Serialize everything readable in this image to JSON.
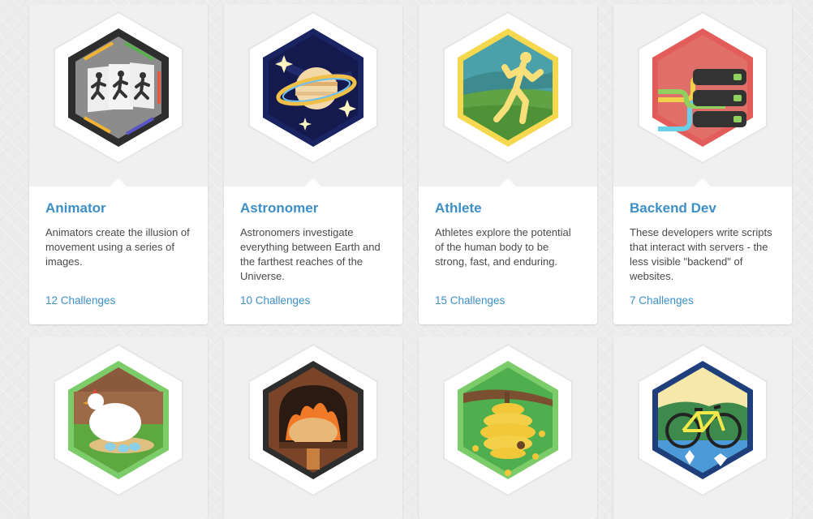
{
  "cards": [
    {
      "title": "Animator",
      "description": "Animators create the illusion of movement using a series of images.",
      "challenges": "12 Challenges",
      "icon": "animator-badge-icon",
      "colors": {
        "border": "#333333",
        "fill": "#8a8a8a"
      }
    },
    {
      "title": "Astronomer",
      "description": "Astronomers investigate everything between Earth and the farthest reaches of the Universe.",
      "challenges": "10 Challenges",
      "icon": "astronomer-badge-icon",
      "colors": {
        "border": "#1e2660",
        "fill": "#18205a"
      }
    },
    {
      "title": "Athlete",
      "description": "Athletes explore the potential of the human body to be strong, fast, and enduring.",
      "challenges": "15 Challenges",
      "icon": "athlete-badge-icon",
      "colors": {
        "border": "#f2d64b",
        "fill": "#4aa0a8"
      }
    },
    {
      "title": "Backend Dev",
      "description": "These developers write scripts that interact with servers - the less visible \"backend\" of websites.",
      "challenges": "7 Challenges",
      "icon": "backend-dev-badge-icon",
      "colors": {
        "border": "#e65c5c",
        "fill": "#df6a66"
      }
    }
  ],
  "row2": [
    {
      "icon": "chicken-nest-badge-icon",
      "colors": {
        "border": "#7ccd6a",
        "fill": "#6fbf5a"
      }
    },
    {
      "icon": "bread-oven-badge-icon",
      "colors": {
        "border": "#333333",
        "fill": "#6b3a22"
      }
    },
    {
      "icon": "beehive-badge-icon",
      "colors": {
        "border": "#7ccd6a",
        "fill": "#4caf50"
      }
    },
    {
      "icon": "bicycle-badge-icon",
      "colors": {
        "border": "#1f3f7a",
        "fill": "#4c9ad8"
      }
    }
  ]
}
